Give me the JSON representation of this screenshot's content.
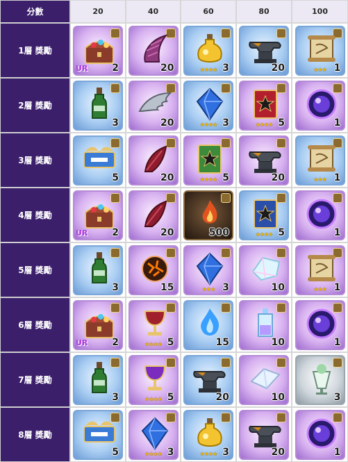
{
  "header": {
    "corner": "分數",
    "scores": [
      "20",
      "40",
      "60",
      "80",
      "100"
    ]
  },
  "rows": [
    {
      "label": "1層 獎勵",
      "items": [
        {
          "icon": "treasure-chest-ur-icon",
          "qty": "2",
          "ur": "UR",
          "stars": "",
          "bg": "purple"
        },
        {
          "icon": "horn-icon",
          "qty": "20",
          "ur": "",
          "stars": "",
          "bg": "purple"
        },
        {
          "icon": "potion-bottle-icon",
          "qty": "3",
          "ur": "",
          "stars": "★★★★",
          "bg": "blue"
        },
        {
          "icon": "anvil-icon",
          "qty": "20",
          "ur": "",
          "stars": "",
          "bg": "blue"
        },
        {
          "icon": "scroll-icon",
          "qty": "1",
          "ur": "",
          "stars": "★★★",
          "bg": "blue"
        }
      ]
    },
    {
      "label": "2層 獎勵",
      "items": [
        {
          "icon": "green-bottle-icon",
          "qty": "3",
          "ur": "",
          "stars": "",
          "bg": "blue"
        },
        {
          "icon": "silver-wing-icon",
          "qty": "20",
          "ur": "",
          "stars": "",
          "bg": "purple"
        },
        {
          "icon": "blue-crystal-icon",
          "qty": "3",
          "ur": "",
          "stars": "★★★★",
          "bg": "blue"
        },
        {
          "icon": "red-spellbook-icon",
          "qty": "5",
          "ur": "",
          "stars": "★★★★",
          "bg": "purple"
        },
        {
          "icon": "magic-orb-icon",
          "qty": "1",
          "ur": "",
          "stars": "",
          "bg": "purple"
        }
      ]
    },
    {
      "label": "3層 獎勵",
      "items": [
        {
          "icon": "ticket-icon",
          "qty": "5",
          "ur": "",
          "stars": "",
          "bg": "blue"
        },
        {
          "icon": "red-feather-icon",
          "qty": "20",
          "ur": "",
          "stars": "",
          "bg": "purple"
        },
        {
          "icon": "green-spellbook-icon",
          "qty": "5",
          "ur": "",
          "stars": "★★★★",
          "bg": "purple"
        },
        {
          "icon": "anvil-icon",
          "qty": "20",
          "ur": "",
          "stars": "",
          "bg": "purple"
        },
        {
          "icon": "scroll-icon",
          "qty": "1",
          "ur": "",
          "stars": "★★★",
          "bg": "blue"
        }
      ]
    },
    {
      "label": "4層 獎勵",
      "items": [
        {
          "icon": "treasure-chest-ur-icon",
          "qty": "2",
          "ur": "UR",
          "stars": "",
          "bg": "purple"
        },
        {
          "icon": "red-feather-icon",
          "qty": "20",
          "ur": "",
          "stars": "",
          "bg": "purple"
        },
        {
          "icon": "dark-flame-icon",
          "qty": "500",
          "ur": "",
          "stars": "",
          "bg": "dark"
        },
        {
          "icon": "blue-spellbook-icon",
          "qty": "5",
          "ur": "",
          "stars": "★★★★",
          "bg": "blue"
        },
        {
          "icon": "magic-orb-icon",
          "qty": "1",
          "ur": "",
          "stars": "",
          "bg": "purple"
        }
      ]
    },
    {
      "label": "5層 獎勵",
      "items": [
        {
          "icon": "green-bottle-icon",
          "qty": "3",
          "ur": "",
          "stars": "",
          "bg": "blue"
        },
        {
          "icon": "molten-rock-icon",
          "qty": "15",
          "ur": "",
          "stars": "",
          "bg": "purple"
        },
        {
          "icon": "blue-crystal-icon",
          "qty": "3",
          "ur": "",
          "stars": "★★★",
          "bg": "purple"
        },
        {
          "icon": "prism-crystal-icon",
          "qty": "10",
          "ur": "",
          "stars": "",
          "bg": "purple"
        },
        {
          "icon": "scroll-icon",
          "qty": "1",
          "ur": "",
          "stars": "★★★",
          "bg": "purple"
        }
      ]
    },
    {
      "label": "6層 獎勵",
      "items": [
        {
          "icon": "treasure-chest-ur-icon",
          "qty": "2",
          "ur": "UR",
          "stars": "",
          "bg": "purple"
        },
        {
          "icon": "golden-chalice-icon",
          "qty": "5",
          "ur": "",
          "stars": "★★★★",
          "bg": "purple"
        },
        {
          "icon": "blue-flame-icon",
          "qty": "15",
          "ur": "",
          "stars": "",
          "bg": "blue"
        },
        {
          "icon": "elixir-bottle-icon",
          "qty": "10",
          "ur": "",
          "stars": "",
          "bg": "purple"
        },
        {
          "icon": "magic-orb-icon",
          "qty": "1",
          "ur": "",
          "stars": "",
          "bg": "purple"
        }
      ]
    },
    {
      "label": "7層 獎勵",
      "items": [
        {
          "icon": "green-bottle-icon",
          "qty": "3",
          "ur": "",
          "stars": "",
          "bg": "blue"
        },
        {
          "icon": "purple-chalice-icon",
          "qty": "5",
          "ur": "",
          "stars": "★★★★",
          "bg": "purple"
        },
        {
          "icon": "anvil-icon",
          "qty": "20",
          "ur": "",
          "stars": "",
          "bg": "blue"
        },
        {
          "icon": "crystal-shard-icon",
          "qty": "10",
          "ur": "",
          "stars": "",
          "bg": "purple"
        },
        {
          "icon": "parfait-icon",
          "qty": "3",
          "ur": "",
          "stars": "",
          "bg": "silver"
        }
      ]
    },
    {
      "label": "8層 獎勵",
      "items": [
        {
          "icon": "ticket-icon",
          "qty": "5",
          "ur": "",
          "stars": "",
          "bg": "blue"
        },
        {
          "icon": "blue-crystal-icon",
          "qty": "3",
          "ur": "",
          "stars": "★★★★",
          "bg": "purple"
        },
        {
          "icon": "potion-bottle-icon",
          "qty": "3",
          "ur": "",
          "stars": "★★★★",
          "bg": "blue"
        },
        {
          "icon": "anvil-icon",
          "qty": "20",
          "ur": "",
          "stars": "",
          "bg": "purple"
        },
        {
          "icon": "magic-orb-icon",
          "qty": "1",
          "ur": "",
          "stars": "",
          "bg": "purple"
        }
      ]
    }
  ],
  "colors": {
    "row_label_bg": "#3b1f6b",
    "header_bg": "#ece9f4",
    "star": "#f2b705",
    "ur": "#b03de0"
  }
}
